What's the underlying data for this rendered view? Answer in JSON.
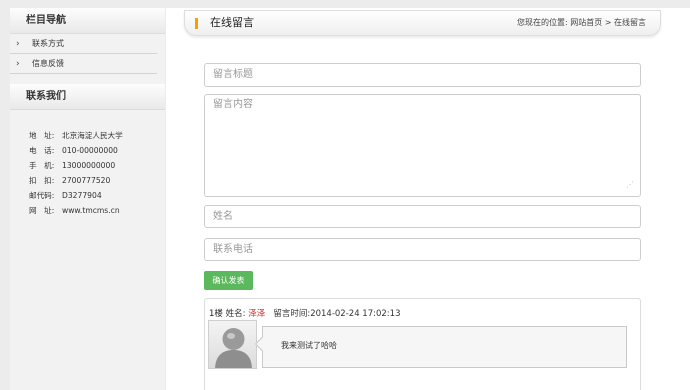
{
  "sidebar": {
    "nav_title": "栏目导航",
    "items": [
      {
        "label": "联系方式",
        "icon": "chevron-right-icon"
      },
      {
        "label": "信息反馈",
        "icon": "chevron-right-icon"
      }
    ],
    "contact_title": "联系我们",
    "contact_rows": [
      {
        "label": "地　址:",
        "value": "北京海淀人民大学"
      },
      {
        "label": "电　话:",
        "value": "010-00000000"
      },
      {
        "label": "手　机:",
        "value": "13000000000"
      },
      {
        "label": "扣　扣:",
        "value": "2700777520"
      },
      {
        "label": "邮代码:",
        "value": "D3277904"
      },
      {
        "label": "网　址:",
        "value": "www.tmcms.cn"
      }
    ]
  },
  "main": {
    "title": "在线留言",
    "breadcrumb": "您现在的位置: 网站首页 > 在线留言",
    "form": {
      "title_placeholder": "留言标题",
      "content_placeholder": "留言内容",
      "name_placeholder": "姓名",
      "phone_placeholder": "联系电话",
      "submit_label": "确认发表"
    },
    "message": {
      "floor": "1楼",
      "name_label": "姓名:",
      "author": "泽泽",
      "time_label": "留言时间:",
      "time": "2014-02-24 17:02:13",
      "content": "我来测试了哈哈"
    }
  },
  "colors": {
    "accent_mark": "#f2a200",
    "submit_button": "#5cb85c",
    "author_name": "#d03030"
  }
}
